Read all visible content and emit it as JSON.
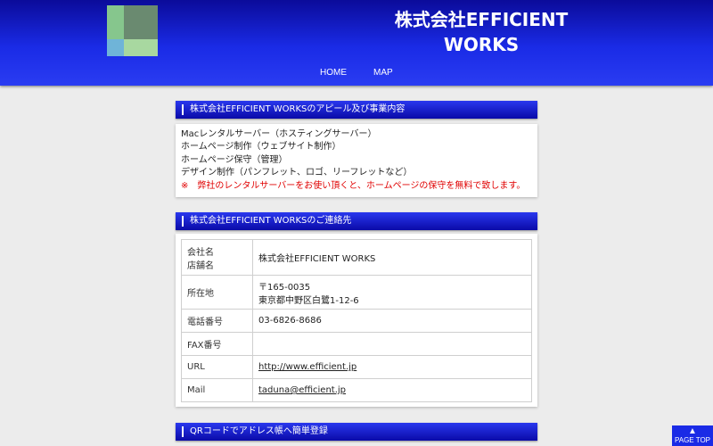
{
  "header": {
    "site_title": "株式会社EFFICIENT WORKS",
    "nav": [
      "HOME",
      "MAP"
    ]
  },
  "sections": {
    "appeal": {
      "title": "株式会社EFFICIENT WORKSのアピール及び事業内容",
      "lines": [
        "Macレンタルサーバー（ホスティングサーバー）",
        "ホームページ制作（ウェブサイト制作）",
        "ホームページ保守（管理）",
        "デザイン制作（パンフレット、ロゴ、リーフレットなど）"
      ],
      "note": "※　弊社のレンタルサーバーをお使い頂くと、ホームページの保守を無料で致します。"
    },
    "contact": {
      "title": "株式会社EFFICIENT WORKSのご連絡先",
      "rows": [
        {
          "key_line1": "会社名",
          "key_line2": "店舗名",
          "value": "株式会社EFFICIENT WORKS"
        },
        {
          "key": "所在地",
          "value_line1": "〒165-0035",
          "value_line2": "東京都中野区白鷺1-12-6"
        },
        {
          "key": "電話番号",
          "value": "03-6826-8686"
        },
        {
          "key": "FAX番号",
          "value": ""
        },
        {
          "key": "URL",
          "value": "http://www.efficient.jp"
        },
        {
          "key": "Mail",
          "value": "taduna@efficient.jp"
        }
      ]
    },
    "qr": {
      "title": "QRコードでアドレス帳へ簡単登録"
    }
  },
  "page_top": {
    "label": "PAGE TOP",
    "icon": "double-chevron-up-icon"
  },
  "colors": {
    "header_blue": "#1a2be6",
    "dark_blue": "#0b0b9a",
    "note_red": "#e00000",
    "background": "#ececec"
  }
}
